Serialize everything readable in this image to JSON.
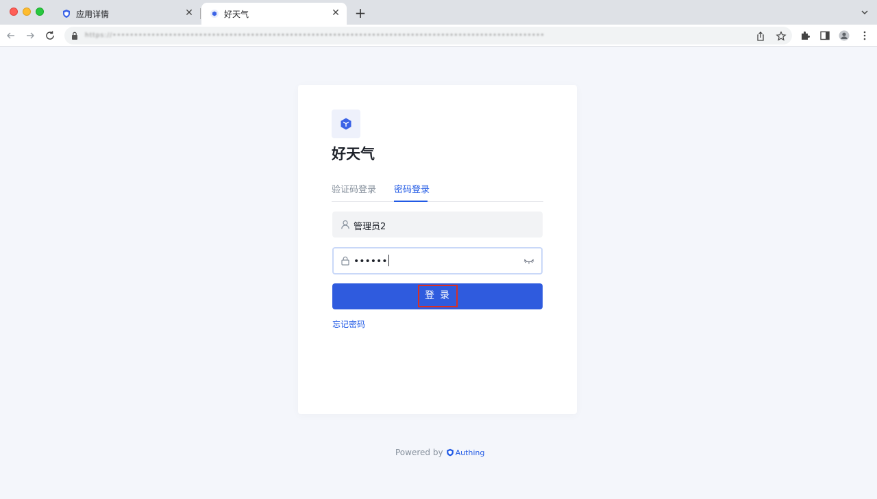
{
  "browser": {
    "tabs": [
      {
        "title": "应用详情",
        "active": false
      },
      {
        "title": "好天气",
        "active": true
      }
    ],
    "url_obscured": "https://••••••••••••••••••••••••••••••••••••••••••••••••••••••••••••••••••••••••••••••••••••••••••••••••••••"
  },
  "app": {
    "name": "好天气",
    "accent": "#215ae5"
  },
  "login": {
    "tabs": [
      "验证码登录",
      "密码登录"
    ],
    "active_tab": 1,
    "username_value": "管理员2",
    "password_value": "••••••",
    "submit_label": "登录",
    "forgot_link": "忘记密码"
  },
  "footer": {
    "powered_by": "Powered by",
    "brand": "Authing"
  }
}
